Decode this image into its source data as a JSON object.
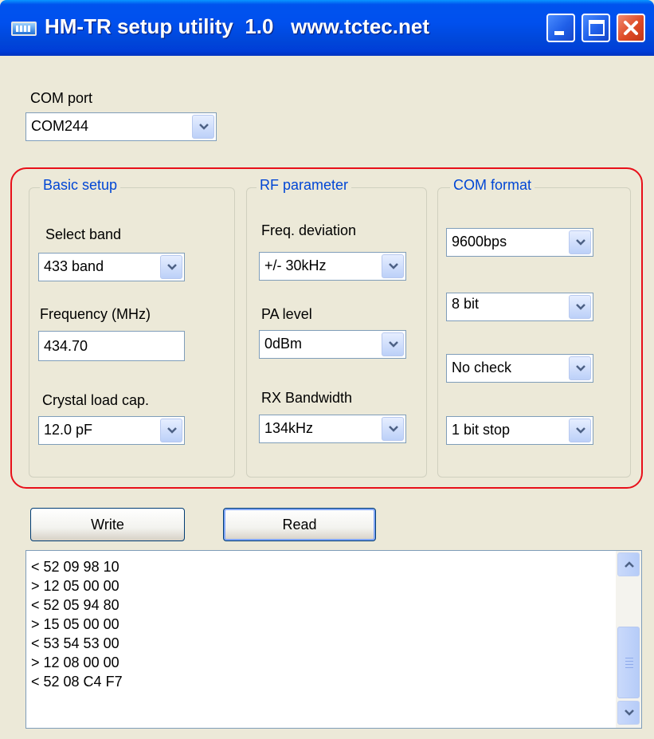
{
  "window": {
    "title": "HM-TR setup utility  1.0   www.tctec.net"
  },
  "com_port": {
    "label": "COM port",
    "value": "COM244"
  },
  "basic_setup": {
    "title": "Basic setup",
    "band_label": "Select band",
    "band_value": "433 band",
    "frequency_label": "Frequency (MHz)",
    "frequency_value": "434.70",
    "crystal_label": "Crystal load cap.",
    "crystal_value": "12.0 pF"
  },
  "rf_parameter": {
    "title": "RF parameter",
    "deviation_label": "Freq. deviation",
    "deviation_value": "+/- 30kHz",
    "pa_label": "PA level",
    "pa_value": "0dBm",
    "rxbw_label": "RX Bandwidth",
    "rxbw_value": "134kHz"
  },
  "com_format": {
    "title": "COM format",
    "baud_value": "9600bps",
    "databits_value": "8 bit",
    "parity_value": "No check",
    "stopbits_value": "1 bit stop"
  },
  "buttons": {
    "write": "Write",
    "read": "Read"
  },
  "log": {
    "lines": [
      "< 52 09 98 10",
      "> 12 05 00 00",
      "< 52 05 94 80",
      "> 15 05 00 00",
      "< 53 54 53 00",
      "> 12 08 00 00",
      "< 52 08 C4 F7"
    ]
  },
  "icons": {
    "app": "app-icon",
    "minimize": "minimize-icon",
    "maximize": "maximize-icon",
    "close": "close-icon",
    "dropdown": "chevron-down-icon",
    "scroll_up": "chevron-up-icon",
    "scroll_down": "chevron-down-icon"
  },
  "colors": {
    "titlebar": "#0054e3",
    "window_bg": "#ece9d8",
    "highlight_frame": "#e8101a",
    "group_title": "#0046d5",
    "close_button": "#de4a26"
  }
}
